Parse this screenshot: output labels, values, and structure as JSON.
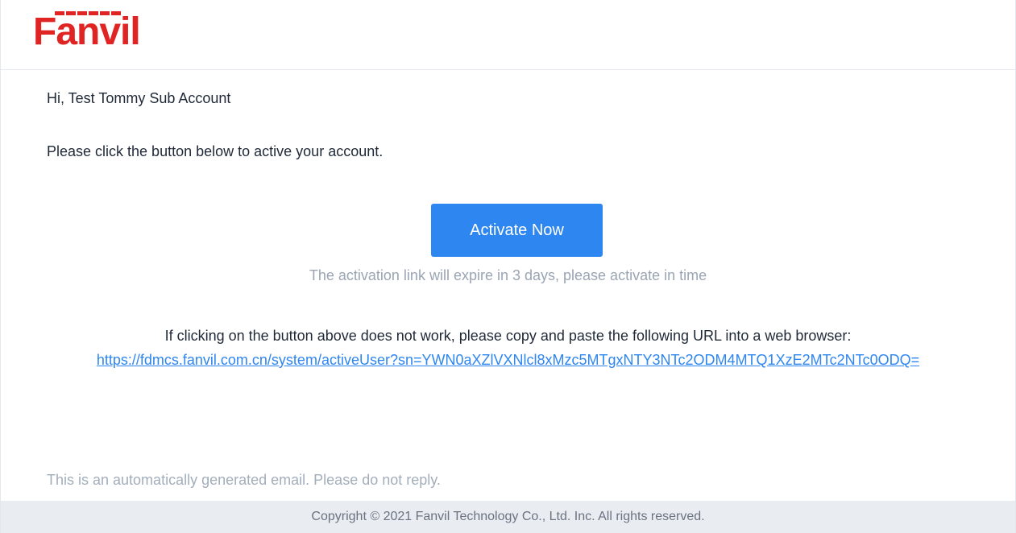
{
  "brand": {
    "logo_text": "Fanvil",
    "logo_color": "#e02424"
  },
  "email": {
    "greeting": "Hi, Test Tommy Sub Account",
    "intro": "Please click the button below to active your account.",
    "button_label": "Activate Now",
    "button_color": "#2e86f0",
    "expire_note": "The activation link will expire in 3 days, please activate in time",
    "fallback_text": "If clicking on the button above does not work, please copy and paste the following URL into a web browser:",
    "activation_url": "https://fdmcs.fanvil.com.cn/system/activeUser?sn=YWN0aXZlVXNlcl8xMzc5MTgxNTY3NTc2ODM4MTQ1XzE2MTc2NTc0ODQ=",
    "auto_note": "This is an automatically generated email. Please do not reply."
  },
  "footer": {
    "copyright": "Copyright © 2021 Fanvil Technology Co., Ltd. Inc. All rights reserved."
  }
}
